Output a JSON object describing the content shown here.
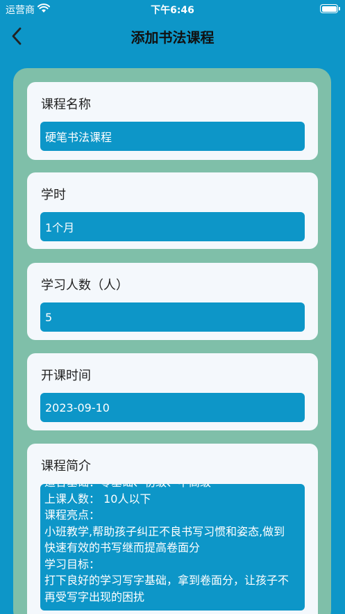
{
  "status": {
    "carrier": "运营商",
    "time": "下午6:46"
  },
  "nav": {
    "title": "添加书法课程"
  },
  "form": {
    "name": {
      "label": "课程名称",
      "value": "硬笔书法课程"
    },
    "hours": {
      "label": "学时",
      "value": "1个月"
    },
    "count": {
      "label": "学习人数（人）",
      "value": "5"
    },
    "start": {
      "label": "开课时间",
      "value": "2023-09-10"
    },
    "intro": {
      "label": "课程简介",
      "lines": [
        "适合基础：零基础、初级、中高级",
        "上课人数： 10人以下",
        "课程亮点：",
        "小班教学,帮助孩子纠正不良书写习惯和姿态,做到",
        "快速有效的书写继而提高卷面分",
        "学习目标：",
        "打下良好的学习写字基础，拿到卷面分，让孩子不",
        "再受写字出现的困扰"
      ]
    }
  },
  "colors": {
    "background": "#0d96c8",
    "panel": "#7fbfa9",
    "card": "#f4f8fc",
    "field": "#0d96c8"
  }
}
